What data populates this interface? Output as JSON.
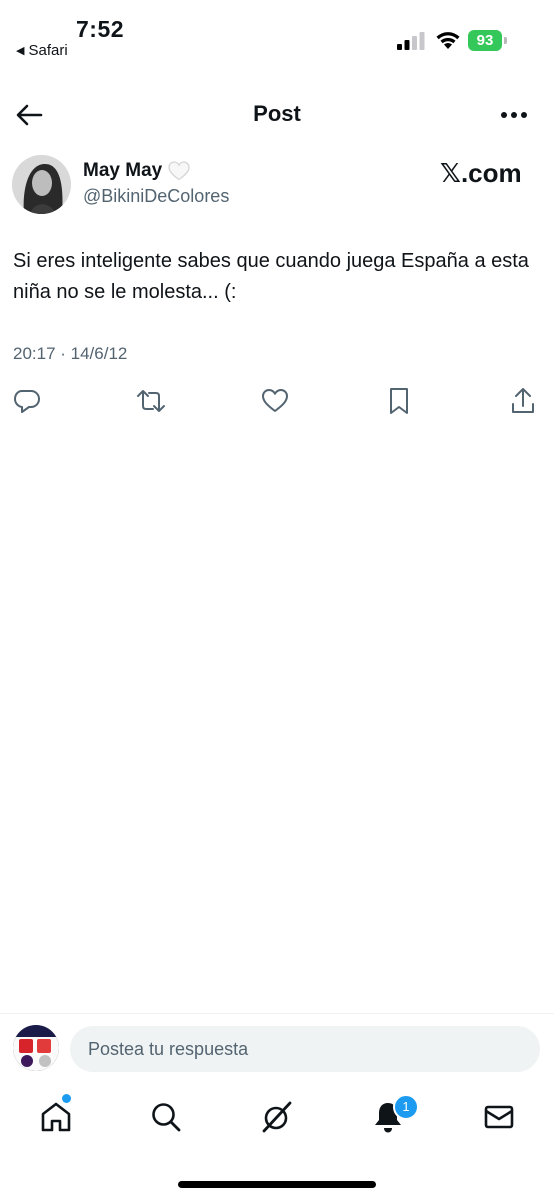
{
  "status_bar": {
    "time": "7:52",
    "back_app": "Safari",
    "battery": "93"
  },
  "header": {
    "title": "Post"
  },
  "author": {
    "display_name": "May May",
    "handle": "@BikiniDeColores"
  },
  "brand": {
    "label": "𝕏.com"
  },
  "tweet": {
    "text": "Si eres inteligente sabes que cuando juega España a esta niña no se le molesta... (:",
    "timestamp": "20:17 · 14/6/12"
  },
  "reply": {
    "placeholder": "Postea tu respuesta"
  },
  "tab_bar": {
    "notifications_badge": "1"
  },
  "icons": {
    "back": "arrow-left-icon",
    "more": "more-horizontal-icon",
    "reply": "reply-icon",
    "repost": "repost-icon",
    "like": "heart-icon",
    "bookmark": "bookmark-icon",
    "share": "share-icon",
    "home": "home-icon",
    "search": "search-icon",
    "grok": "grok-icon",
    "notifications": "bell-icon",
    "messages": "mail-icon"
  },
  "colors": {
    "accent": "#1d9bf0",
    "muted_text": "#536471",
    "battery": "#34c759"
  }
}
